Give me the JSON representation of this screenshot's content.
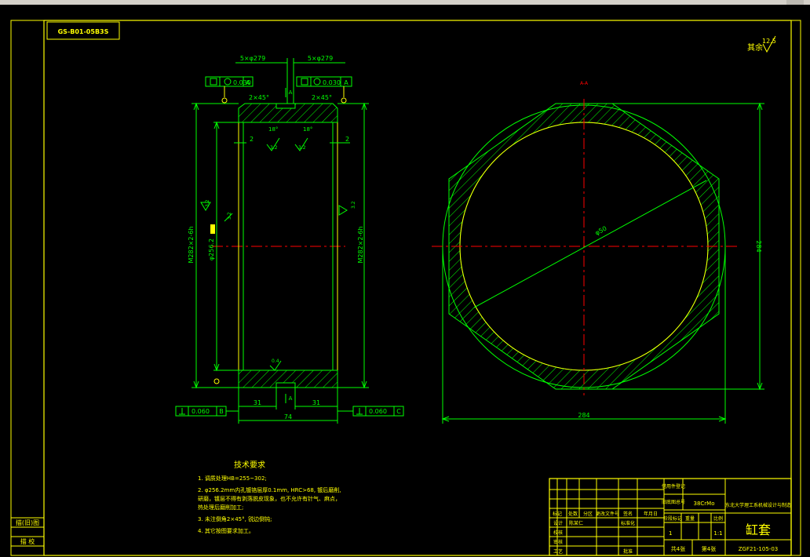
{
  "colors": {
    "frame": "#ffff00",
    "part": "#00ff00",
    "center": "#ff0000",
    "dim": "#ffffff"
  },
  "drawing": {
    "code_box": "GS-B01-05B3S",
    "roughness_note": "其余",
    "roughness_value": "12.5",
    "section_label": "A-A"
  },
  "left_view": {
    "top_dim_left": "5×φ279",
    "top_dim_right": "5×φ279",
    "tol_left_value": "0.030",
    "tol_left_datum": "A",
    "tol_right_value": "0.030",
    "tol_right_datum": "A",
    "chamfer_left": "2×45°",
    "chamfer_right": "2×45°",
    "mark_a_top": "A",
    "mark_a_bottom": "A",
    "angle_left": "18°",
    "angle_right": "18°",
    "step_left": "2",
    "step_right": "2",
    "rough_32_1": "3.2",
    "rough_32_2": "3.2",
    "rough_32_3": "3.2",
    "rough_32_4": "3.2",
    "rough_32_5": "3.2",
    "rough_04": "0.4",
    "label_left_thread": "M282×2-6h",
    "label_right_thread": "M282×2-6h",
    "label_bore": "φ256.2",
    "dim_31_left": "31",
    "dim_31_right": "31",
    "dim_74": "74",
    "tol_bottom_left_value": "0.060",
    "tol_bottom_left_datum": "B",
    "tol_bottom_right_value": "0.060",
    "tol_bottom_right_datum": "C"
  },
  "right_view": {
    "dim_diameter": "φ50",
    "dim_vertical": "284",
    "dim_horizontal": "284"
  },
  "notes": {
    "heading": "技术要求",
    "lines": [
      "1. 调质处理HB=255~302;",
      "2. φ256.2mm内孔镀铬层厚0.1mm, HRC>68, 镀后磨削,",
      "   研磨，镀层不得有剥落脱皮现象，也不允许有针气、麻点，",
      "   热处理后磨削加工;",
      "3. 未注倒角2×45°, 锐边倒钝;",
      "4. 其它按图要求加工。"
    ]
  },
  "side_table": {
    "top": "描(旧)图",
    "bottom": "描   校"
  },
  "title_block": {
    "part_name": "缸套",
    "material": "38CrMo",
    "school": "东北大学理工系机械设计与制造",
    "qty": "1",
    "scale": "1:1",
    "sheet_total": "共4张",
    "sheet_no": "第4张",
    "drawing_no": "ZGF21-105-03",
    "col_headers": [
      "标记",
      "处数",
      "分区",
      "更改文件号",
      "签名",
      "年月日"
    ],
    "row_labels": [
      "设计",
      "校核",
      "审核",
      "工艺"
    ],
    "designer": "陈某仁",
    "std_label": "标准化",
    "approve_label": "批准",
    "label_stage": "阶段标记",
    "label_weight": "重量",
    "label_scale": "比例",
    "right_top_labels": [
      "借用件登记",
      "旧底图总号"
    ]
  }
}
